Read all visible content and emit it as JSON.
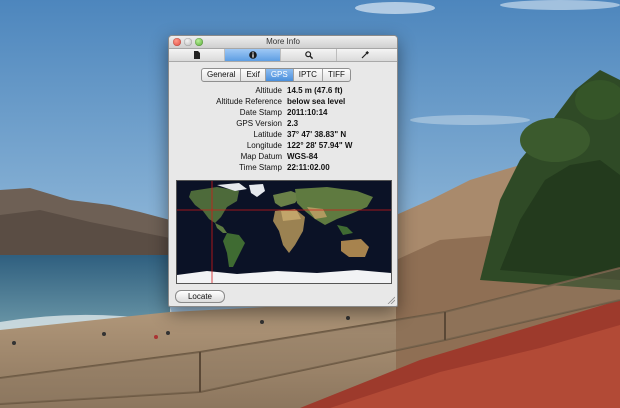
{
  "window": {
    "title": "More Info"
  },
  "toolbar": {
    "items": [
      {
        "name": "document-icon"
      },
      {
        "name": "info-icon",
        "selected": true
      },
      {
        "name": "magnifier-icon"
      },
      {
        "name": "eyedropper-icon"
      }
    ]
  },
  "tabs": [
    {
      "label": "General"
    },
    {
      "label": "Exif"
    },
    {
      "label": "GPS",
      "selected": true
    },
    {
      "label": "IPTC"
    },
    {
      "label": "TIFF"
    }
  ],
  "gps": [
    {
      "label": "Altitude",
      "value": "14.5 m (47.6 ft)"
    },
    {
      "label": "Altitude Reference",
      "value": "below sea level"
    },
    {
      "label": "Date Stamp",
      "value": "2011:10:14"
    },
    {
      "label": "GPS Version",
      "value": "2.3"
    },
    {
      "label": "Latitude",
      "value": "37° 47' 38.83\" N"
    },
    {
      "label": "Longitude",
      "value": "122° 28' 57.94\" W"
    },
    {
      "label": "Map Datum",
      "value": "WGS-84"
    },
    {
      "label": "Time Stamp",
      "value": "22:11:02.00"
    }
  ],
  "locate_button": {
    "label": "Locate"
  },
  "colors": {
    "selection": "#5e9ee3",
    "map_ocean": "#0b1226",
    "marker": "#d11a1a"
  }
}
